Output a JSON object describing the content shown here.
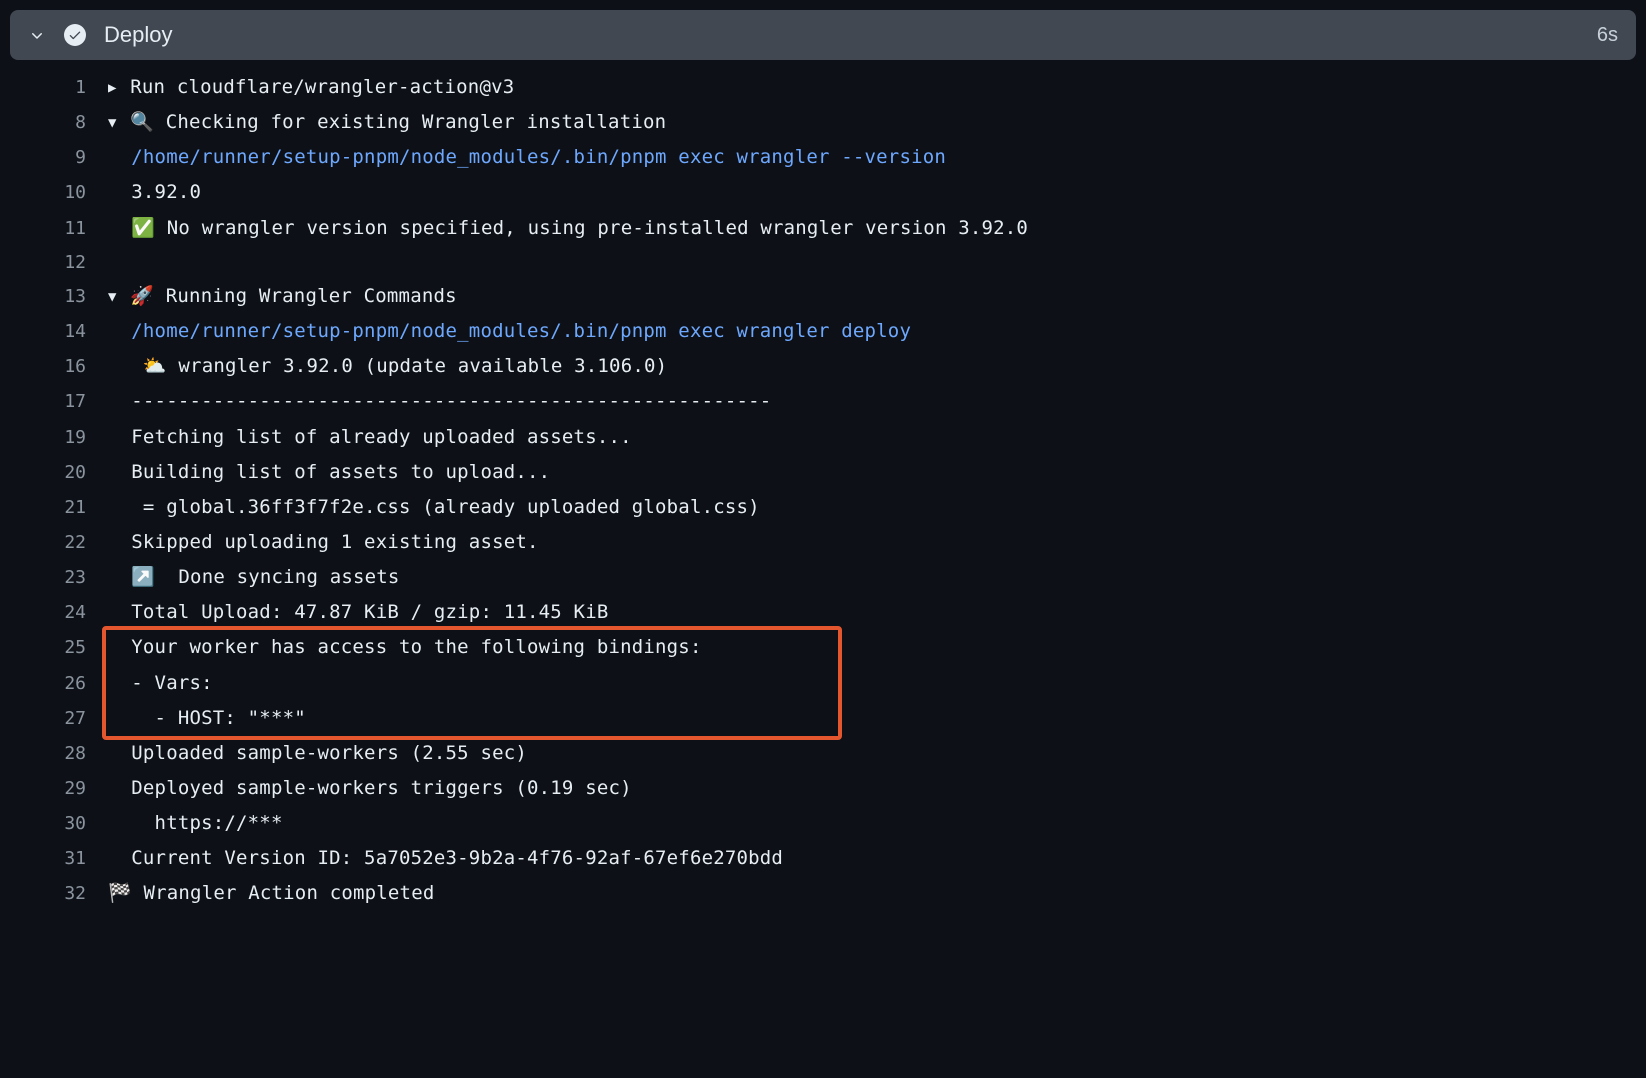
{
  "header": {
    "title": "Deploy",
    "duration": "6s"
  },
  "lines": [
    {
      "no": "1",
      "fold": "right",
      "text": "Run cloudflare/wrangler-action@v3"
    },
    {
      "no": "8",
      "fold": "down",
      "text": "🔍 Checking for existing Wrangler installation"
    },
    {
      "no": "9",
      "indent": 1,
      "cmd": true,
      "text": "/home/runner/setup-pnpm/node_modules/.bin/pnpm exec wrangler --version"
    },
    {
      "no": "10",
      "indent": 1,
      "text": "3.92.0"
    },
    {
      "no": "11",
      "indent": 1,
      "text": "✅ No wrangler version specified, using pre-installed wrangler version 3.92.0"
    },
    {
      "no": "12",
      "text": ""
    },
    {
      "no": "13",
      "fold": "down",
      "text": "🚀 Running Wrangler Commands"
    },
    {
      "no": "14",
      "indent": 1,
      "cmd": true,
      "text": "/home/runner/setup-pnpm/node_modules/.bin/pnpm exec wrangler deploy"
    },
    {
      "no": "16",
      "indent": 1,
      "text": " ⛅️ wrangler 3.92.0 (update available 3.106.0)"
    },
    {
      "no": "17",
      "indent": 1,
      "text": "-------------------------------------------------------"
    },
    {
      "no": "19",
      "indent": 1,
      "text": "Fetching list of already uploaded assets..."
    },
    {
      "no": "20",
      "indent": 1,
      "text": "Building list of assets to upload..."
    },
    {
      "no": "21",
      "indent": 1,
      "text": " = global.36ff3f7f2e.css (already uploaded global.css)"
    },
    {
      "no": "22",
      "indent": 1,
      "text": "Skipped uploading 1 existing asset."
    },
    {
      "no": "23",
      "indent": 1,
      "text": "↗️  Done syncing assets"
    },
    {
      "no": "24",
      "indent": 1,
      "text": "Total Upload: 47.87 KiB / gzip: 11.45 KiB"
    },
    {
      "no": "25",
      "indent": 1,
      "hl": true,
      "text": "Your worker has access to the following bindings:"
    },
    {
      "no": "26",
      "indent": 1,
      "hl": true,
      "text": "- Vars:"
    },
    {
      "no": "27",
      "indent": 1,
      "hl": true,
      "text": "  - HOST: \"***\""
    },
    {
      "no": "28",
      "indent": 1,
      "text": "Uploaded sample-workers (2.55 sec)"
    },
    {
      "no": "29",
      "indent": 1,
      "text": "Deployed sample-workers triggers (0.19 sec)"
    },
    {
      "no": "30",
      "indent": 1,
      "text": "  https://***"
    },
    {
      "no": "31",
      "indent": 1,
      "text": "Current Version ID: 5a7052e3-9b2a-4f76-92af-67ef6e270bdd"
    },
    {
      "no": "32",
      "text": "🏁 Wrangler Action completed"
    }
  ]
}
